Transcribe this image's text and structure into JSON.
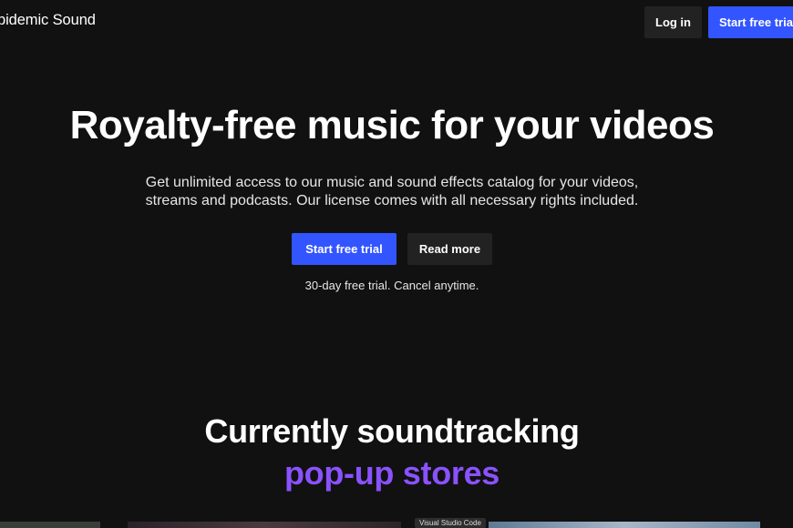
{
  "header": {
    "logo_text": "pidemic Sound",
    "login_label": "Log in",
    "trial_label": "Start free trial"
  },
  "hero": {
    "title": "Royalty-free music for your videos",
    "subtitle_line1": "Get unlimited access to our music and sound effects catalog for your videos,",
    "subtitle_line2": "streams and podcasts. Our license comes with all necessary rights included.",
    "primary_cta": "Start free trial",
    "secondary_cta": "Read more",
    "note": "30-day free trial. Cancel anytime."
  },
  "soundtracking": {
    "title": "Currently soundtracking",
    "highlight": "pop-up stores"
  },
  "overlay": {
    "tooltip": "Visual Studio Code"
  },
  "colors": {
    "background": "#111111",
    "accent_blue": "#3355ff",
    "secondary_button": "#222222",
    "highlight_purple": "#8a52ff"
  }
}
